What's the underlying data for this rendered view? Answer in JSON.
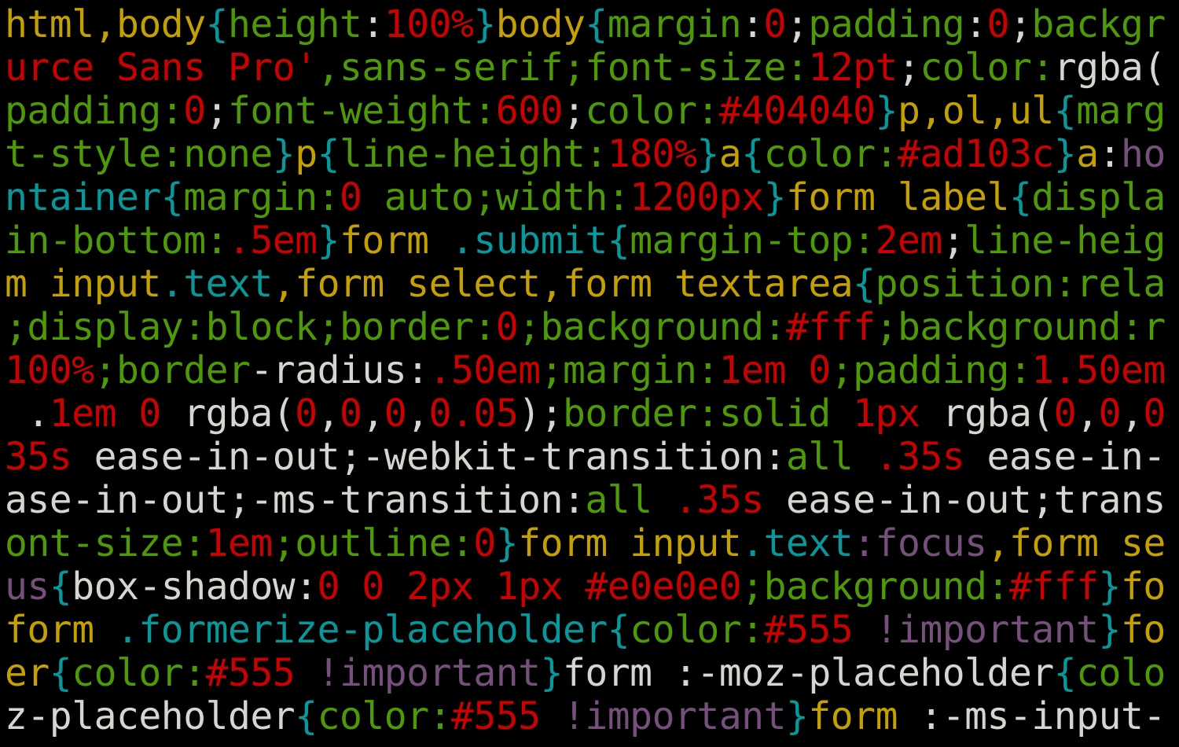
{
  "colors": {
    "background": "#000000",
    "yellow": "#c4a000",
    "teal": "#06989a",
    "green": "#4e9a06",
    "red": "#cc0000",
    "purple": "#75507b",
    "white": "#d3d7cf"
  },
  "lines": [
    {
      "segments": [
        {
          "text": "html,body",
          "color": "yellow"
        },
        {
          "text": "{",
          "color": "teal"
        },
        {
          "text": "height",
          "color": "green"
        },
        {
          "text": ":",
          "color": "white"
        },
        {
          "text": "100%",
          "color": "red"
        },
        {
          "text": "}",
          "color": "teal"
        },
        {
          "text": "body",
          "color": "yellow"
        },
        {
          "text": "{",
          "color": "teal"
        },
        {
          "text": "margin",
          "color": "green"
        },
        {
          "text": ":",
          "color": "white"
        },
        {
          "text": "0",
          "color": "red"
        },
        {
          "text": ";",
          "color": "white"
        },
        {
          "text": "padding",
          "color": "green"
        },
        {
          "text": ":",
          "color": "white"
        },
        {
          "text": "0",
          "color": "red"
        },
        {
          "text": ";",
          "color": "white"
        },
        {
          "text": "backgr",
          "color": "green"
        }
      ]
    },
    {
      "segments": [
        {
          "text": "urce Sans Pro'",
          "color": "red"
        },
        {
          "text": ",sans-serif;font-size:",
          "color": "green"
        },
        {
          "text": "12pt",
          "color": "red"
        },
        {
          "text": ";",
          "color": "white"
        },
        {
          "text": "color:",
          "color": "green"
        },
        {
          "text": "rgba(",
          "color": "white"
        }
      ]
    },
    {
      "segments": [
        {
          "text": "padding:",
          "color": "green"
        },
        {
          "text": "0",
          "color": "red"
        },
        {
          "text": ";",
          "color": "white"
        },
        {
          "text": "font-weight:",
          "color": "green"
        },
        {
          "text": "600",
          "color": "red"
        },
        {
          "text": ";",
          "color": "white"
        },
        {
          "text": "color:",
          "color": "green"
        },
        {
          "text": "#404040",
          "color": "red"
        },
        {
          "text": "}",
          "color": "teal"
        },
        {
          "text": "p,ol,ul",
          "color": "yellow"
        },
        {
          "text": "{",
          "color": "teal"
        },
        {
          "text": "marg",
          "color": "green"
        }
      ]
    },
    {
      "segments": [
        {
          "text": "t-style:none",
          "color": "green"
        },
        {
          "text": "}",
          "color": "teal"
        },
        {
          "text": "p",
          "color": "yellow"
        },
        {
          "text": "{",
          "color": "teal"
        },
        {
          "text": "line-height:",
          "color": "green"
        },
        {
          "text": "180%",
          "color": "red"
        },
        {
          "text": "}",
          "color": "teal"
        },
        {
          "text": "a",
          "color": "yellow"
        },
        {
          "text": "{",
          "color": "teal"
        },
        {
          "text": "color:",
          "color": "green"
        },
        {
          "text": "#ad103c",
          "color": "red"
        },
        {
          "text": "}",
          "color": "teal"
        },
        {
          "text": "a",
          "color": "yellow"
        },
        {
          "text": ":",
          "color": "white"
        },
        {
          "text": "ho",
          "color": "purple"
        }
      ]
    },
    {
      "segments": [
        {
          "text": "ntainer",
          "color": "teal"
        },
        {
          "text": "{",
          "color": "teal"
        },
        {
          "text": "margin:",
          "color": "green"
        },
        {
          "text": "0",
          "color": "red"
        },
        {
          "text": " auto;width:",
          "color": "green"
        },
        {
          "text": "1200px",
          "color": "red"
        },
        {
          "text": "}",
          "color": "teal"
        },
        {
          "text": "form label",
          "color": "yellow"
        },
        {
          "text": "{",
          "color": "teal"
        },
        {
          "text": "displa",
          "color": "green"
        }
      ]
    },
    {
      "segments": [
        {
          "text": "in-bottom:",
          "color": "green"
        },
        {
          "text": ".5em",
          "color": "red"
        },
        {
          "text": "}",
          "color": "teal"
        },
        {
          "text": "form ",
          "color": "yellow"
        },
        {
          "text": ".submit",
          "color": "teal"
        },
        {
          "text": "{",
          "color": "teal"
        },
        {
          "text": "margin-top:",
          "color": "green"
        },
        {
          "text": "2em",
          "color": "red"
        },
        {
          "text": ";",
          "color": "white"
        },
        {
          "text": "line-heig",
          "color": "green"
        }
      ]
    },
    {
      "segments": [
        {
          "text": "m input",
          "color": "yellow"
        },
        {
          "text": ".text",
          "color": "teal"
        },
        {
          "text": ",form select,form textarea",
          "color": "yellow"
        },
        {
          "text": "{",
          "color": "teal"
        },
        {
          "text": "position:rela",
          "color": "green"
        }
      ]
    },
    {
      "segments": [
        {
          "text": ";display:block;border:",
          "color": "green"
        },
        {
          "text": "0",
          "color": "red"
        },
        {
          "text": ";background:",
          "color": "green"
        },
        {
          "text": "#fff",
          "color": "red"
        },
        {
          "text": ";background:r",
          "color": "green"
        }
      ]
    },
    {
      "segments": [
        {
          "text": "100%",
          "color": "red"
        },
        {
          "text": ";border",
          "color": "green"
        },
        {
          "text": "-radius:",
          "color": "white"
        },
        {
          "text": ".50em",
          "color": "red"
        },
        {
          "text": ";margin:",
          "color": "green"
        },
        {
          "text": "1em 0",
          "color": "red"
        },
        {
          "text": ";padding:",
          "color": "green"
        },
        {
          "text": "1.50em",
          "color": "red"
        }
      ]
    },
    {
      "segments": [
        {
          "text": " .",
          "color": "white"
        },
        {
          "text": "1em 0",
          "color": "red"
        },
        {
          "text": " rgba(",
          "color": "white"
        },
        {
          "text": "0",
          "color": "red"
        },
        {
          "text": ",",
          "color": "white"
        },
        {
          "text": "0",
          "color": "red"
        },
        {
          "text": ",",
          "color": "white"
        },
        {
          "text": "0",
          "color": "red"
        },
        {
          "text": ",",
          "color": "white"
        },
        {
          "text": "0.05",
          "color": "red"
        },
        {
          "text": ");",
          "color": "white"
        },
        {
          "text": "border:solid ",
          "color": "green"
        },
        {
          "text": "1px",
          "color": "red"
        },
        {
          "text": " rgba(",
          "color": "white"
        },
        {
          "text": "0",
          "color": "red"
        },
        {
          "text": ",",
          "color": "white"
        },
        {
          "text": "0",
          "color": "red"
        },
        {
          "text": ",",
          "color": "white"
        },
        {
          "text": "0",
          "color": "red"
        }
      ]
    },
    {
      "segments": [
        {
          "text": "35s",
          "color": "red"
        },
        {
          "text": " ease-in-out;-webkit-transition:",
          "color": "white"
        },
        {
          "text": "all ",
          "color": "green"
        },
        {
          "text": ".35s",
          "color": "red"
        },
        {
          "text": " ease-in-",
          "color": "white"
        }
      ]
    },
    {
      "segments": [
        {
          "text": "ase-in-out;-ms-transition:",
          "color": "white"
        },
        {
          "text": "all ",
          "color": "green"
        },
        {
          "text": ".35s",
          "color": "red"
        },
        {
          "text": " ease-in-out;trans",
          "color": "white"
        }
      ]
    },
    {
      "segments": [
        {
          "text": "ont-size:",
          "color": "green"
        },
        {
          "text": "1em",
          "color": "red"
        },
        {
          "text": ";outline:",
          "color": "green"
        },
        {
          "text": "0",
          "color": "red"
        },
        {
          "text": "}",
          "color": "teal"
        },
        {
          "text": "form input",
          "color": "yellow"
        },
        {
          "text": ".text",
          "color": "teal"
        },
        {
          "text": ":focus",
          "color": "purple"
        },
        {
          "text": ",form se",
          "color": "yellow"
        }
      ]
    },
    {
      "segments": [
        {
          "text": "us",
          "color": "purple"
        },
        {
          "text": "{",
          "color": "teal"
        },
        {
          "text": "box-shadow:",
          "color": "white"
        },
        {
          "text": "0 0 2px 1px #e0e0e0",
          "color": "red"
        },
        {
          "text": ";background:",
          "color": "green"
        },
        {
          "text": "#fff",
          "color": "red"
        },
        {
          "text": "}",
          "color": "teal"
        },
        {
          "text": "fo",
          "color": "yellow"
        }
      ]
    },
    {
      "segments": [
        {
          "text": "form ",
          "color": "yellow"
        },
        {
          "text": ".formerize-placeholder",
          "color": "teal"
        },
        {
          "text": "{",
          "color": "teal"
        },
        {
          "text": "color:",
          "color": "green"
        },
        {
          "text": "#555",
          "color": "red"
        },
        {
          "text": " !important",
          "color": "purple"
        },
        {
          "text": "}",
          "color": "teal"
        },
        {
          "text": "fo",
          "color": "yellow"
        }
      ]
    },
    {
      "segments": [
        {
          "text": "er",
          "color": "yellow"
        },
        {
          "text": "{",
          "color": "teal"
        },
        {
          "text": "color:",
          "color": "green"
        },
        {
          "text": "#555",
          "color": "red"
        },
        {
          "text": " !important",
          "color": "purple"
        },
        {
          "text": "}",
          "color": "teal"
        },
        {
          "text": "form :-moz-placeholder",
          "color": "white"
        },
        {
          "text": "{",
          "color": "teal"
        },
        {
          "text": "colo",
          "color": "green"
        }
      ]
    },
    {
      "segments": [
        {
          "text": "z-placeholder",
          "color": "white"
        },
        {
          "text": "{",
          "color": "teal"
        },
        {
          "text": "color:",
          "color": "green"
        },
        {
          "text": "#555",
          "color": "red"
        },
        {
          "text": " !important",
          "color": "purple"
        },
        {
          "text": "}",
          "color": "teal"
        },
        {
          "text": "form ",
          "color": "yellow"
        },
        {
          "text": ":-ms-input-",
          "color": "white"
        }
      ]
    }
  ]
}
